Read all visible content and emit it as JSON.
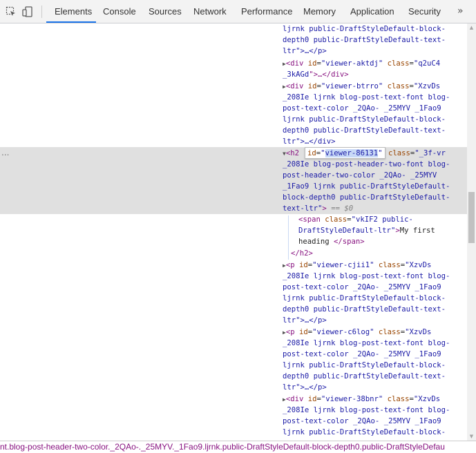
{
  "toolbar": {
    "tabs": [
      {
        "label": "Elements",
        "active": true
      },
      {
        "label": "Console"
      },
      {
        "label": "Sources"
      },
      {
        "label": "Network"
      },
      {
        "label": "Performance"
      },
      {
        "label": "Memory"
      },
      {
        "label": "Application"
      },
      {
        "label": "Security"
      }
    ],
    "more_icon": "»",
    "inspect_icon": "inspect-element-icon",
    "device_icon": "device-toolbar-icon"
  },
  "tree": {
    "p_top_tail": [
      "ljrnk public-DraftStyleDefault-block-",
      "depth0 public-DraftStyleDefault-text-",
      "ltr\">…</p>"
    ],
    "div_aktdj": {
      "tag": "div",
      "id": "viewer-aktdj",
      "class_1": "q2uC4",
      "class_2": "_3kAGd",
      "tail": "\">…</div>"
    },
    "div_btrro": {
      "tag": "div",
      "id": "viewer-btrro",
      "class_1": "XzvDs",
      "lines": [
        "_208Ie ljrnk blog-post-text-font blog-",
        "post-text-color _2QAo- _25MYV _1Fao9",
        "ljrnk public-DraftStyleDefault-block-",
        "depth0 public-DraftStyleDefault-text-"
      ],
      "tail": "ltr\">…</div>"
    },
    "h2": {
      "tag": "h2",
      "id_attr": "id",
      "id_value": "viewer-86131",
      "class_1": "_3f-vr",
      "lines": [
        "_208Ie blog-post-header-two-font blog-",
        "post-header-two-color _2QAo- _25MYV",
        "_1Fao9 ljrnk public-DraftStyleDefault-",
        "block-depth0 public-DraftStyleDefault-"
      ],
      "last": "text-ltr",
      "dollar": "== $0",
      "dots": "..."
    },
    "span": {
      "class_1": "vkIF2 public-",
      "class_2": "DraftStyleDefault-ltr",
      "text_1": "My first",
      "text_2": "heading ",
      "close": "</span>"
    },
    "h2_close": "</h2>",
    "p_cjii1": {
      "tag": "p",
      "id": "viewer-cjii1",
      "class_1": "XzvDs",
      "lines": [
        "_208Ie ljrnk blog-post-text-font blog-",
        "post-text-color _2QAo- _25MYV _1Fao9",
        "ljrnk public-DraftStyleDefault-block-",
        "depth0 public-DraftStyleDefault-text-"
      ],
      "tail": "ltr\">…</p>"
    },
    "p_c6log": {
      "tag": "p",
      "id": "viewer-c6log",
      "class_1": "XzvDs",
      "lines": [
        "_208Ie ljrnk blog-post-text-font blog-",
        "post-text-color _2QAo- _25MYV _1Fao9",
        "ljrnk public-DraftStyleDefault-block-",
        "depth0 public-DraftStyleDefault-text-"
      ],
      "tail": "ltr\">…</p>"
    },
    "div_38bnr": {
      "tag": "div",
      "id": "viewer-38bnr",
      "class_1": "XzvDs",
      "lines": [
        "_208Ie ljrnk blog-post-text-font blog-",
        "post-text-color _2QAo- _25MYV _1Fao9",
        "ljrnk public-DraftStyleDefault-block-"
      ]
    }
  },
  "breadcrumb": "nt.blog-post-header-two-color._2QAo-._25MYV._1Fao9.ljrnk.public-DraftStyleDefault-block-depth0.public-DraftStyleDefau"
}
